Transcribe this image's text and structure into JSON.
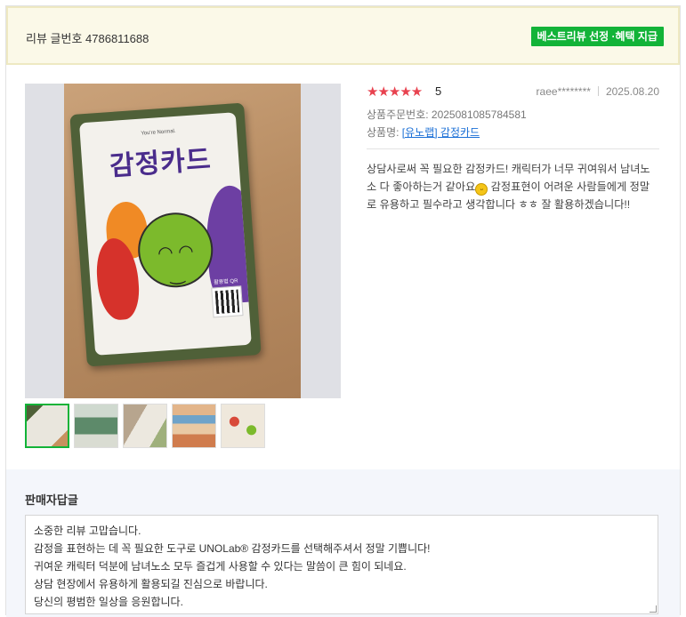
{
  "header": {
    "review_number": "리뷰 글번호 4786811688",
    "best_badge": "베스트리뷰 선정 ·혜택 지급"
  },
  "photo": {
    "card_subtitle": "You're Normal.",
    "card_title": "감정카드",
    "qr_label": "활용법 QR",
    "thumbnail_count": 5,
    "active_thumbnail": 1
  },
  "review": {
    "rating": "5",
    "stars": "★★★★★",
    "author": "raee********",
    "date": "2025.08.20",
    "order_number": "상품주문번호: 2025081085784581",
    "product_label": "상품명: ",
    "product_name": "[유노랩] 감정카드",
    "text_part1": "상담사로써 꼭 필요한 감정카드! 캐릭터가 너무 귀여워서 남녀노소 다 좋아하는거 같아요",
    "text_part2": " 감정표현이 어려운 사람들에게 정말로 유용하고 필수라고 생각합니다 ㅎㅎ 잘 활용하겠습니다!!"
  },
  "seller_reply": {
    "heading": "판매자답글",
    "lines": [
      "소중한 리뷰 고맙습니다.",
      "감정을 표현하는 데 꼭 필요한 도구로 UNOLab® 감정카드를 선택해주셔서 정말 기쁩니다!",
      "귀여운 캐릭터 덕분에 남녀노소 모두 즐겁게 사용할 수 있다는 말씀이 큰 힘이 되네요.",
      "상담 현장에서 유용하게 활용되길 진심으로 바랍니다.",
      "당신의 평범한 일상을 응원합니다."
    ]
  },
  "colors": {
    "accent_green": "#12b338",
    "star_red": "#e8424f",
    "link_blue": "#1a6fd6",
    "header_bg": "#fbf9e8"
  }
}
